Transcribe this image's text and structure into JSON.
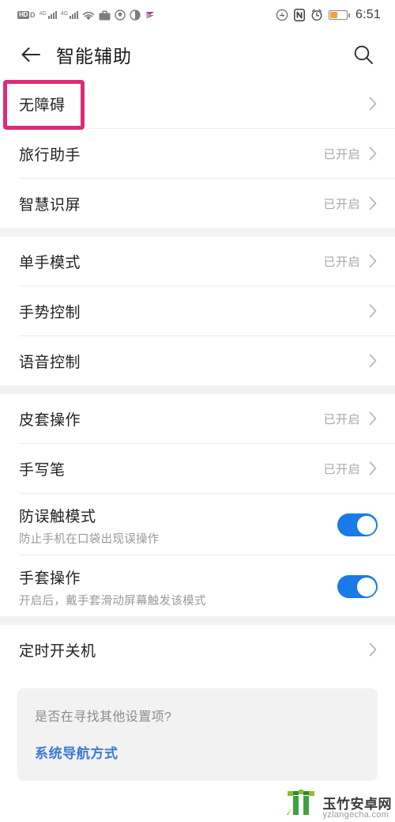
{
  "statusbar": {
    "left_icons": [
      "hd-voice-icon",
      "signal-4g-icon-1",
      "signal-4g-icon-2",
      "wifi-icon",
      "briefcase-icon",
      "vpn-icon",
      "data-saver-icon",
      "app-logo-icon"
    ],
    "hd_label": "HD",
    "hd_sub": "D",
    "network_label": "4G",
    "right_icons": [
      "do-not-disturb-icon",
      "nfc-icon",
      "alarm-icon",
      "battery-icon"
    ],
    "nfc_label": "N",
    "battery_percent": 45,
    "time": "6:51"
  },
  "header": {
    "back_icon": "back-arrow-icon",
    "title": "智能辅助",
    "search_icon": "search-icon"
  },
  "highlight": {
    "color": "#e02a77",
    "target": "无障碍"
  },
  "groups": [
    {
      "rows": [
        {
          "title": "无障碍",
          "value": "",
          "type": "link",
          "highlighted": true
        },
        {
          "title": "旅行助手",
          "value": "已开启",
          "type": "link"
        },
        {
          "title": "智慧识屏",
          "value": "已开启",
          "type": "link"
        }
      ]
    },
    {
      "rows": [
        {
          "title": "单手模式",
          "value": "已开启",
          "type": "link"
        },
        {
          "title": "手势控制",
          "value": "",
          "type": "link"
        },
        {
          "title": "语音控制",
          "value": "",
          "type": "link"
        }
      ]
    },
    {
      "rows": [
        {
          "title": "皮套操作",
          "value": "已开启",
          "type": "link"
        },
        {
          "title": "手写笔",
          "value": "已开启",
          "type": "link"
        },
        {
          "title": "防误触模式",
          "subtitle": "防止手机在口袋出现误操作",
          "type": "toggle",
          "toggle_on": true
        },
        {
          "title": "手套操作",
          "subtitle": "开启后，戴手套滑动屏幕触发该模式",
          "type": "toggle",
          "toggle_on": true
        }
      ]
    },
    {
      "rows": [
        {
          "title": "定时开关机",
          "value": "",
          "type": "link"
        }
      ]
    }
  ],
  "card": {
    "question": "是否在寻找其他设置项?",
    "link": "系统导航方式"
  },
  "watermark": {
    "logo_icon": "bamboo-logo-icon",
    "name_cn": "玉竹安卓网",
    "name_en": "yzlangecha.com"
  },
  "colors": {
    "accent_blue": "#1a7ae8",
    "link_blue": "#3a7bd5",
    "highlight_pink": "#e02a77",
    "group_gap": "#f2f2f2"
  }
}
